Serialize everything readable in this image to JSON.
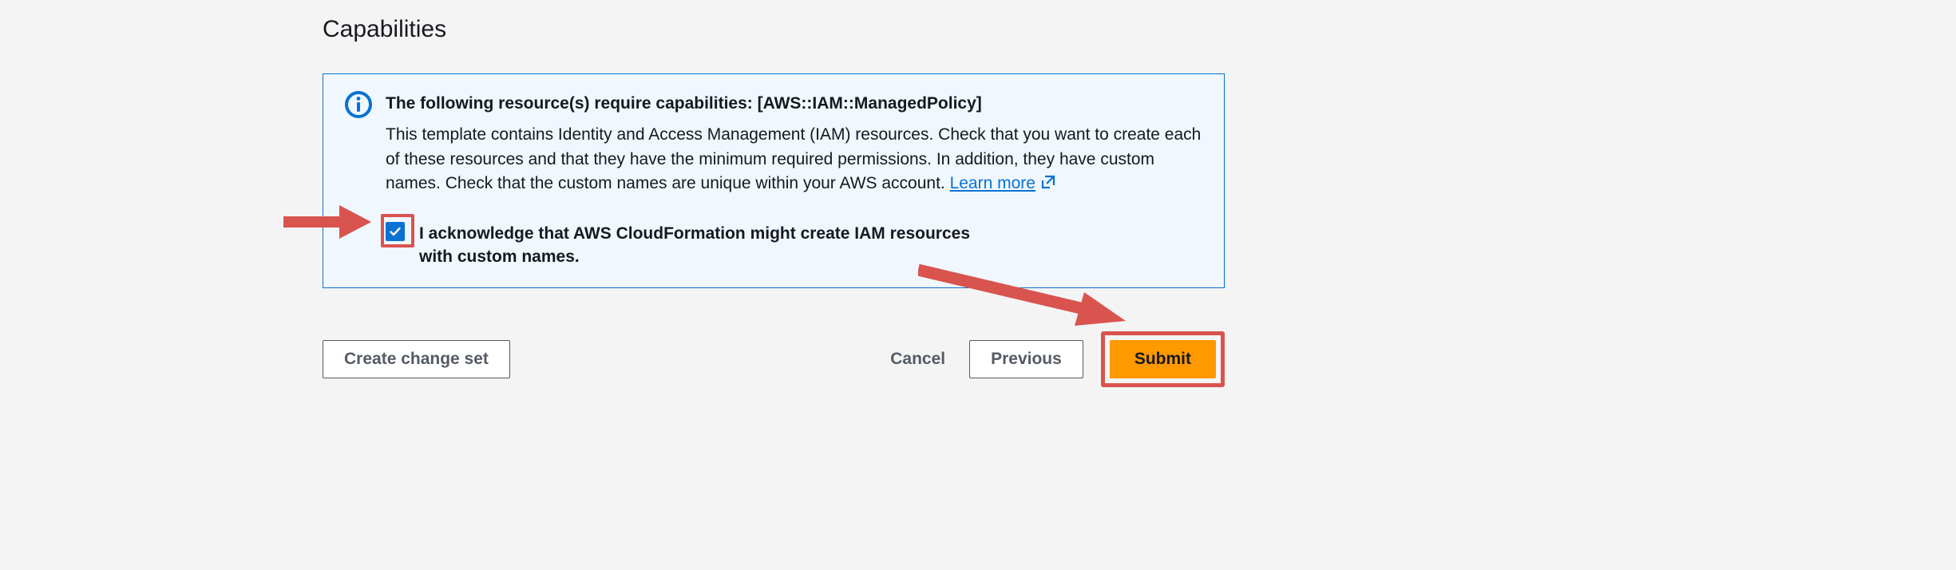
{
  "section": {
    "heading": "Capabilities"
  },
  "infoBox": {
    "title": "The following resource(s) require capabilities: [AWS::IAM::ManagedPolicy]",
    "body": "This template contains Identity and Access Management (IAM) resources. Check that you want to create each of these resources and that they have the minimum required permissions. In addition, they have custom names. Check that the custom names are unique within your AWS account. ",
    "learnMore": "Learn more"
  },
  "acknowledge": {
    "checked": true,
    "label": "I acknowledge that AWS CloudFormation might create IAM resources with custom names."
  },
  "buttons": {
    "createChangeSet": "Create change set",
    "cancel": "Cancel",
    "previous": "Previous",
    "submit": "Submit"
  },
  "colors": {
    "accent": "#0972d3",
    "primary": "#ff9900",
    "annotation": "#d9534f"
  }
}
